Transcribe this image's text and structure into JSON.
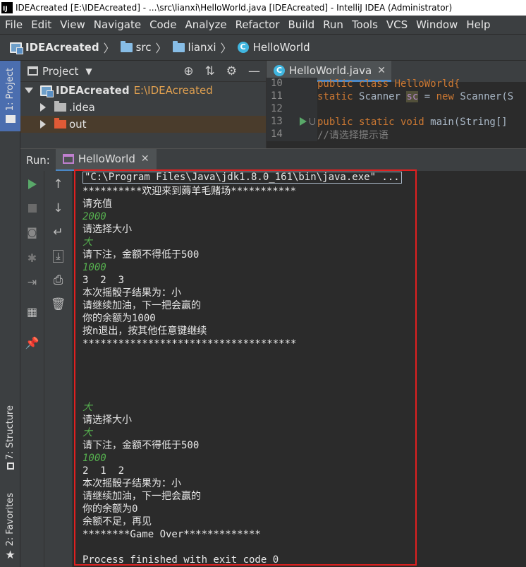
{
  "window": {
    "app_icon": "IJ",
    "title": "IDEAcreated [E:\\IDEAcreated] - ...\\src\\lianxi\\HelloWorld.java [IDEAcreated] - IntelliJ IDEA (Administrator)"
  },
  "menu": [
    "File",
    "Edit",
    "View",
    "Navigate",
    "Code",
    "Analyze",
    "Refactor",
    "Build",
    "Run",
    "Tools",
    "VCS",
    "Window",
    "Help"
  ],
  "breadcrumb": [
    "IDEAcreated",
    "src",
    "lianxi",
    "HelloWorld"
  ],
  "sidebar": {
    "project_tab": "1: Project",
    "structure_tab": "7: Structure",
    "favorites_tab": "2: Favorites"
  },
  "project_panel": {
    "title": "Project",
    "tree": [
      {
        "name": "IDEAcreated",
        "path": "E:\\IDEAcreated"
      },
      {
        "name": ".idea"
      },
      {
        "name": "out"
      }
    ]
  },
  "editor": {
    "tab_label": "HelloWorld.java",
    "lines": [
      {
        "num": "10",
        "text": "public class HelloWorld{"
      },
      {
        "num": "11",
        "kw1": "static",
        "type": "Scanner",
        "var": "sc",
        "rest": " = ",
        "kw2": "new",
        "tail": " Scanner(S"
      },
      {
        "num": "12",
        "text": ""
      },
      {
        "num": "13",
        "kw1": "public static void",
        "tail": " main(String[]"
      },
      {
        "num": "14",
        "text": "//请选择提示语"
      }
    ]
  },
  "run": {
    "label": "Run:",
    "tab_label": "HelloWorld"
  },
  "console": [
    {
      "type": "cmd",
      "text": "\"C:\\Program Files\\Java\\jdk1.8.0_161\\bin\\java.exe\" ..."
    },
    {
      "type": "out",
      "text": "**********欢迎来到薅羊毛赌场***********"
    },
    {
      "type": "out",
      "text": "请充值"
    },
    {
      "type": "in",
      "text": "2000"
    },
    {
      "type": "out",
      "text": "请选择大小"
    },
    {
      "type": "in",
      "text": "大"
    },
    {
      "type": "out",
      "text": "请下注，金额不得低于500"
    },
    {
      "type": "in",
      "text": "1000"
    },
    {
      "type": "out",
      "text": "3  2  3"
    },
    {
      "type": "out",
      "text": "本次摇骰子结果为：小"
    },
    {
      "type": "out",
      "text": "请继续加油，下一把会赢的"
    },
    {
      "type": "out",
      "text": "你的余额为1000"
    },
    {
      "type": "out",
      "text": "按n退出，按其他任意键继续"
    },
    {
      "type": "out",
      "text": "************************************"
    },
    {
      "type": "out",
      "text": ""
    },
    {
      "type": "out",
      "text": ""
    },
    {
      "type": "out",
      "text": ""
    },
    {
      "type": "out",
      "text": ""
    },
    {
      "type": "in",
      "text": "大"
    },
    {
      "type": "out",
      "text": "请选择大小"
    },
    {
      "type": "in",
      "text": "大"
    },
    {
      "type": "out",
      "text": "请下注，金额不得低于500"
    },
    {
      "type": "in",
      "text": "1000"
    },
    {
      "type": "out",
      "text": "2  1  2"
    },
    {
      "type": "out",
      "text": "本次摇骰子结果为：小"
    },
    {
      "type": "out",
      "text": "请继续加油，下一把会赢的"
    },
    {
      "type": "out",
      "text": "你的余额为0"
    },
    {
      "type": "out",
      "text": "余额不足，再见"
    },
    {
      "type": "out",
      "text": "********Game Over*************"
    },
    {
      "type": "out",
      "text": ""
    },
    {
      "type": "out",
      "text": "Process finished with exit code 0"
    }
  ],
  "colors": {
    "accent": "#4a88c7",
    "highlight_box": "#e02020",
    "input_text": "#56b14f"
  }
}
